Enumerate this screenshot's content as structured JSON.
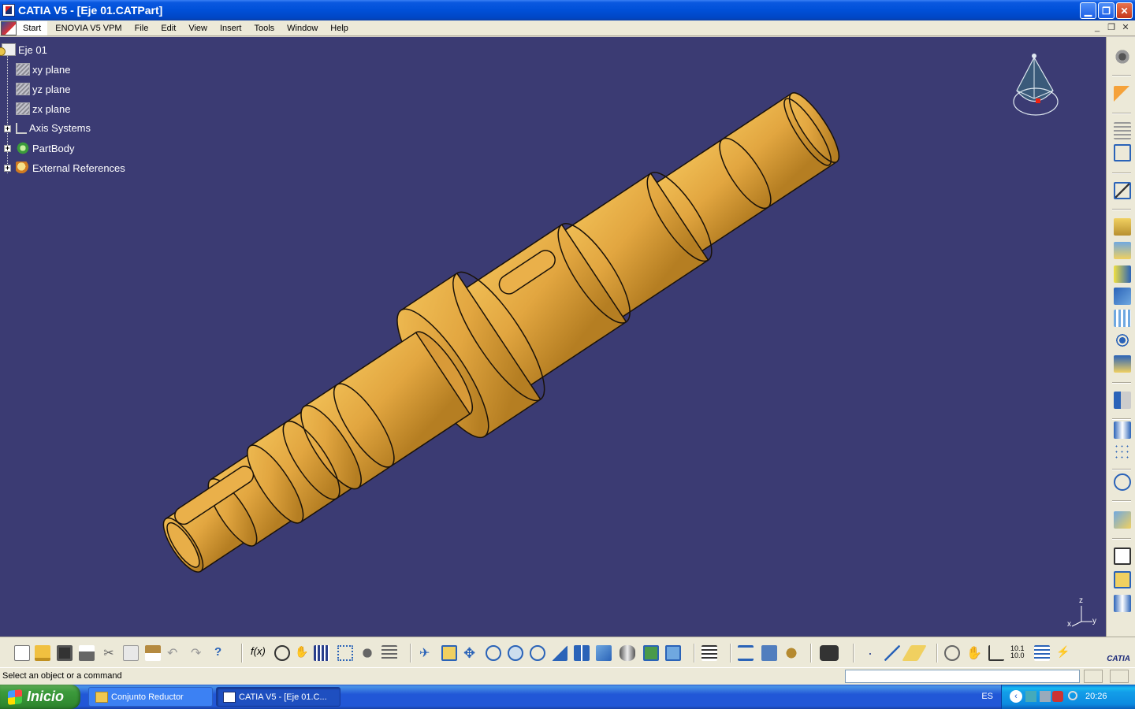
{
  "window": {
    "title": "CATIA V5 - [Eje 01.CATPart]",
    "buttons": [
      "minimize",
      "restore",
      "close"
    ]
  },
  "menu": {
    "items": [
      "Start",
      "ENOVIA V5 VPM",
      "File",
      "Edit",
      "View",
      "Insert",
      "Tools",
      "Window",
      "Help"
    ]
  },
  "tree": {
    "root": "Eje 01",
    "nodes": [
      {
        "label": "xy plane",
        "icon": "plane-icon"
      },
      {
        "label": "yz plane",
        "icon": "plane-icon"
      },
      {
        "label": "zx plane",
        "icon": "plane-icon"
      },
      {
        "label": "Axis Systems",
        "icon": "axis-systems-icon",
        "expandable": true
      },
      {
        "label": "PartBody",
        "icon": "partbody-icon",
        "expandable": true
      },
      {
        "label": "External References",
        "icon": "external-references-icon",
        "expandable": true
      }
    ]
  },
  "viewport": {
    "background": "#3b3b73",
    "part_color": "#e0a43f",
    "triad_labels": {
      "z": "z",
      "x": "x",
      "y": "y"
    }
  },
  "right_toolbar": {
    "icons": [
      "sketcher-settings-icon",
      "select-arrow-icon",
      "table-icon",
      "frame-icon",
      "sketch-icon",
      "pad-icon",
      "pocket-icon",
      "shaft-icon",
      "groove-icon",
      "hole-icon",
      "rib-icon",
      "fillet-icon",
      "chamfer-icon",
      "draft-icon",
      "shell-icon",
      "pattern-icon",
      "transform-icon",
      "boolean-icon",
      "split-icon",
      "thickness-icon",
      "measure-icon"
    ]
  },
  "bottom_toolbar": {
    "icons": [
      "new-icon",
      "open-icon",
      "save-icon",
      "print-icon",
      "cut-icon",
      "copy-icon",
      "paste-icon",
      "undo-icon",
      "redo-icon",
      "whats-this-icon",
      "formula-icon",
      "knowledge-icon",
      "light-icon",
      "table-icon",
      "tree-icon",
      "catalog-icon",
      "product-icon",
      "fly-icon",
      "fit-all-icon",
      "pan-icon",
      "rotate-icon",
      "zoom-in-icon",
      "zoom-out-icon",
      "normal-view-icon",
      "multi-view-icon",
      "iso-view-icon",
      "render-style-icon",
      "hide-show-icon",
      "swap-space-icon",
      "measure-between-icon",
      "measure-item-icon",
      "inertia-icon",
      "capture-icon",
      "point-icon",
      "line-icon",
      "plane-icon",
      "spiral-icon",
      "hand-icon",
      "axis-icon",
      "value-icon",
      "update-icon",
      "analysis-icon"
    ],
    "logo_text": "CATIA"
  },
  "status": {
    "message": "Select an object or a command",
    "command_input": ""
  },
  "taskbar": {
    "start_label": "Inicio",
    "tasks": [
      {
        "label": "Conjunto Reductor",
        "icon": "folder-icon"
      },
      {
        "label": "CATIA V5 - [Eje 01.C...",
        "icon": "catia-icon"
      }
    ],
    "language": "ES",
    "clock": "20:26"
  },
  "colors": {
    "accent": "#0a58e0",
    "viewport_bg": "#3b3b73",
    "part": "#e0a43f"
  }
}
